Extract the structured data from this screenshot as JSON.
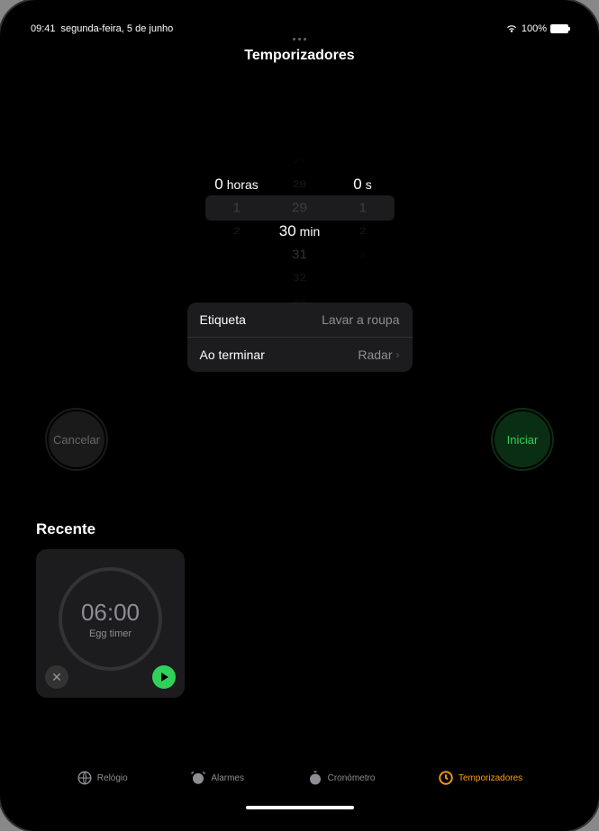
{
  "status": {
    "time": "09:41",
    "date": "segunda-feira, 5 de junho",
    "battery": "100%"
  },
  "title": "Temporizadores",
  "picker": {
    "hours": {
      "selected": "0",
      "label": "horas",
      "below": [
        "1",
        "2"
      ]
    },
    "minutes": {
      "above": [
        "27",
        "28",
        "29"
      ],
      "selected": "30",
      "label": "min",
      "below": [
        "31",
        "32",
        "33"
      ]
    },
    "seconds": {
      "selected": "0",
      "label": "s",
      "below": [
        "1",
        "2",
        "3"
      ]
    }
  },
  "settings": {
    "label_key": "Etiqueta",
    "label_value": "Lavar a roupa",
    "end_key": "Ao terminar",
    "end_value": "Radar"
  },
  "buttons": {
    "cancel": "Cancelar",
    "start": "Iniciar"
  },
  "recent": {
    "title": "Recente",
    "time": "06:00",
    "label": "Egg timer"
  },
  "tabs": {
    "clock": "Relógio",
    "alarms": "Alarmes",
    "stopwatch": "Cronómetro",
    "timers": "Temporizadores"
  }
}
